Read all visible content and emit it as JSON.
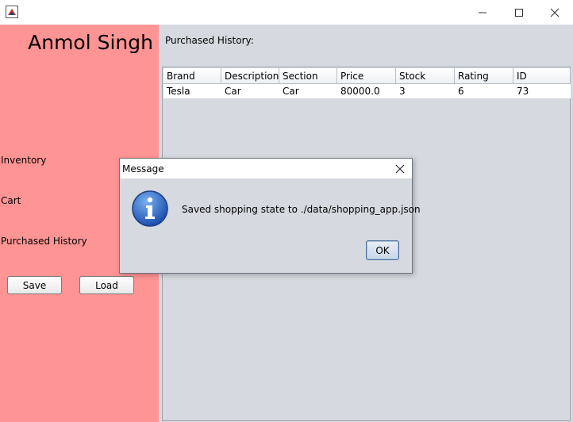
{
  "window": {
    "icon": "java-app-icon",
    "controls": {
      "minimize": "minimize-icon",
      "maximize": "maximize-icon",
      "close": "close-icon"
    }
  },
  "sidebar": {
    "user_name": "Anmol Singh",
    "links": {
      "inventory": "Inventory",
      "cart": "Cart",
      "purchased_history": "Purchased History"
    },
    "buttons": {
      "save": "Save",
      "load": "Load"
    },
    "background_color": "#ff9494"
  },
  "main": {
    "title": "Purchased History:",
    "table": {
      "columns": [
        "Brand",
        "Description",
        "Section",
        "Price",
        "Stock",
        "Rating",
        "ID"
      ],
      "rows": [
        [
          "Tesla",
          "Car",
          "Car",
          "80000.0",
          "3",
          "6",
          "73"
        ]
      ]
    }
  },
  "dialog": {
    "title": "Message",
    "message": "Saved shopping state to ./data/shopping_app.json",
    "ok_label": "OK",
    "icon": "info-icon"
  }
}
